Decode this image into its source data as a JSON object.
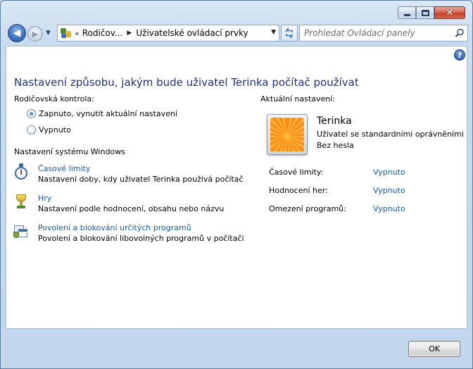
{
  "navigation": {
    "breadcrumb_root": "Rodičov...",
    "breadcrumb_current": "Uživatelské ovládací prvky",
    "search_placeholder": "Prohledat Ovládací panely"
  },
  "page": {
    "title": "Nastavení způsobu, jakým bude uživatel Terinka počítač používat",
    "parental_control_label": "Rodičovská kontrola:",
    "radio_on_label": "Zapnuto, vynutit aktuální nastavení",
    "radio_off_label": "Vypnuto",
    "radio_selected": "on",
    "windows_settings_label": "Nastavení systému Windows"
  },
  "tasks": [
    {
      "icon": "stopwatch-icon",
      "link": "Časové limity",
      "description": "Nastavení doby, kdy uživatel Terinka používá počítač"
    },
    {
      "icon": "trophy-icon",
      "link": "Hry",
      "description": "Nastavení podle hodnocení, obsahu nebo názvu"
    },
    {
      "icon": "programs-icon",
      "link": "Povolení a blokování určitých programů",
      "description": "Povolení a blokování libovolných programů v počítači"
    }
  ],
  "current_settings": {
    "label": "Aktuální nastavení:",
    "user_name": "Terinka",
    "user_role": "Uživatel se standardními oprávněními",
    "user_password": "Bez hesla",
    "rows": [
      {
        "label": "Časové limity:",
        "value": "Vypnuto"
      },
      {
        "label": "Hodnocení her:",
        "value": "Vypnuto"
      },
      {
        "label": "Omezení programů:",
        "value": "Vypnuto"
      }
    ]
  },
  "footer": {
    "ok_label": "OK"
  },
  "colors": {
    "title_blue": "#1e3287",
    "link_blue": "#0d5bc1"
  }
}
